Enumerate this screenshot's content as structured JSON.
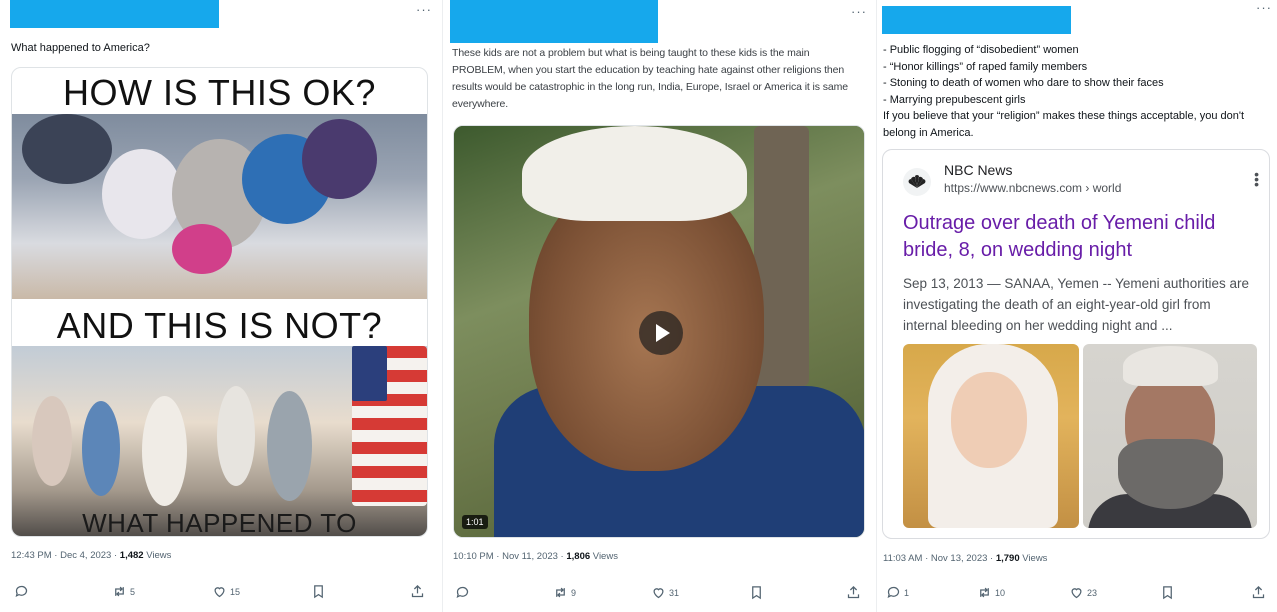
{
  "posts": [
    {
      "text": "What happened to America?",
      "meme_captions": [
        "HOW IS THIS OK?",
        "AND THIS IS NOT?",
        "WHAT HAPPENED TO AMERICA?"
      ],
      "time": "12:43 PM · Dec 4, 2023 · ",
      "views_count": "1,482",
      "views_label": " Views",
      "replies": "",
      "reposts": "5",
      "likes": "15"
    },
    {
      "text": "These kids are not a problem but what is being taught to these kids is the main PROBLEM, when you start the education by teaching hate against other religions then results would be catastrophic in the long run, India, Europe, Israel or America it is same everywhere.",
      "video_duration": "1:01",
      "time": "10:10 PM · Nov 11, 2023 · ",
      "views_count": "1,806",
      "views_label": " Views",
      "replies": "",
      "reposts": "9",
      "likes": "31"
    },
    {
      "text_lines": [
        "- Public flogging of “disobedient” women",
        "- “Honor killings” of raped family members",
        "- Stoning to death of women who dare to show their faces",
        "- Marrying prepubescent girls",
        "If you believe that your “religion” makes these things acceptable, you don't belong in America."
      ],
      "news": {
        "source": "NBC News",
        "url": "https://www.nbcnews.com › world",
        "title": "Outrage over death of Yemeni child bride, 8, on wedding night",
        "snippet": "Sep 13, 2013 — SANAA, Yemen -- Yemeni authorities are investigating the death of an eight-year-old girl from internal bleeding on her wedding night and ..."
      },
      "time": "11:03 AM · Nov 13, 2023 · ",
      "views_count": "1,790",
      "views_label": " Views",
      "replies": "1",
      "reposts": "10",
      "likes": "23"
    }
  ],
  "more_label": "···",
  "colors": {
    "redaction": "#16a8ec",
    "link_visited": "#681da8",
    "muted": "#536471"
  },
  "icons": [
    "reply-icon",
    "repost-icon",
    "like-icon",
    "bookmark-icon",
    "share-icon",
    "play-icon",
    "nbc-peacock-icon",
    "kebab-icon"
  ]
}
